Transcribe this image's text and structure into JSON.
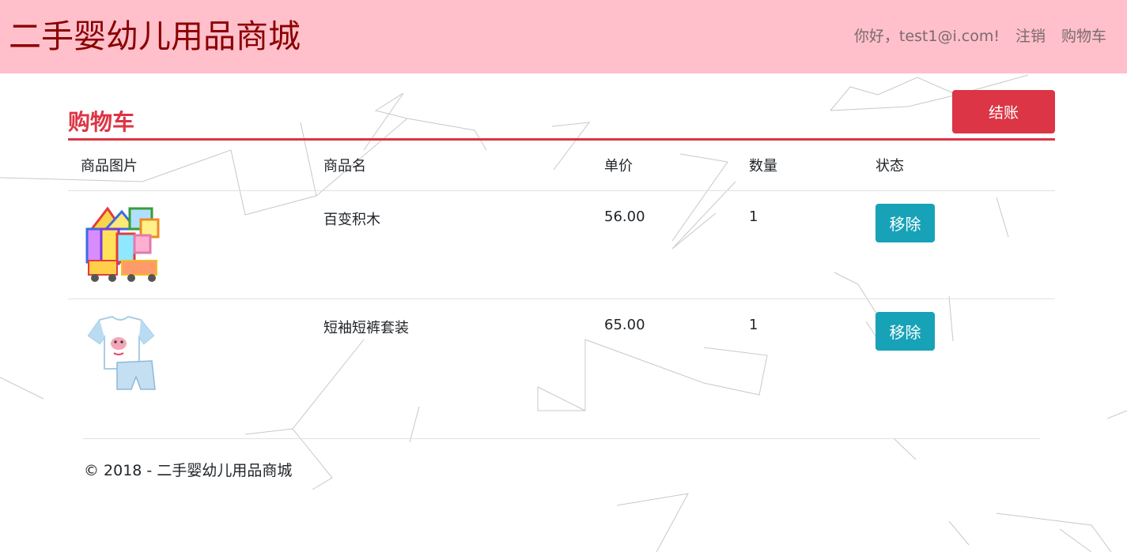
{
  "header": {
    "brand": "二手婴幼儿用品商城",
    "greeting": "你好，test1@i.com!",
    "logout_label": "注销",
    "cart_label": "购物车"
  },
  "cart": {
    "title": "购物车",
    "checkout_label": "结账",
    "columns": [
      "商品图片",
      "商品名",
      "单价",
      "数量",
      "状态"
    ],
    "items": [
      {
        "image": "magnetic-blocks-toy-image",
        "name": "百变积木",
        "price": "56.00",
        "quantity": "1",
        "action_label": "移除"
      },
      {
        "image": "tshirt-shorts-set-image",
        "name": "短袖短裤套装",
        "price": "65.00",
        "quantity": "1",
        "action_label": "移除"
      }
    ]
  },
  "footer": {
    "copyright": "© 2018 - 二手婴幼儿用品商城"
  },
  "colors": {
    "navbar_bg": "#ffc0cb",
    "brand_text": "#8b0000",
    "accent_red": "#dc3545",
    "remove_button": "#17a2b8"
  }
}
